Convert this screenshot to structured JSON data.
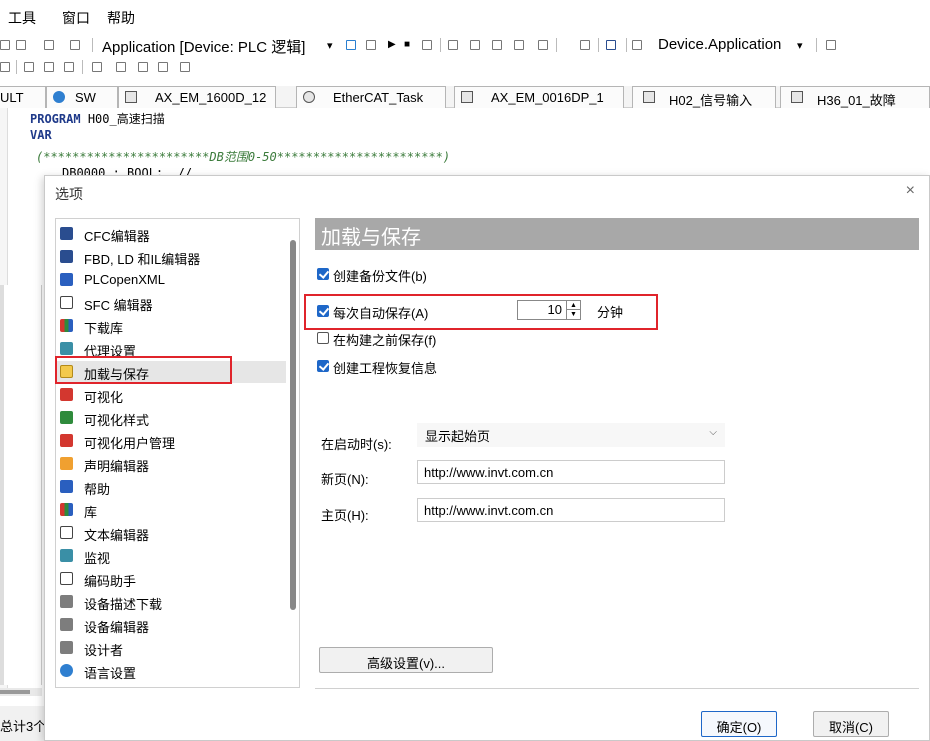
{
  "menu": {
    "items": [
      "工具",
      "窗口",
      "帮助"
    ]
  },
  "toolbar": {
    "app_combo": "Application [Device: PLC 逻辑]",
    "device_combo": "Device.Application"
  },
  "tabs": [
    {
      "label": "ULT"
    },
    {
      "label": "SW"
    },
    {
      "label": "AX_EM_1600D_12"
    },
    {
      "label": "EtherCAT_Task"
    },
    {
      "label": "AX_EM_0016DP_1"
    },
    {
      "label": "H02_信号输入"
    },
    {
      "label": "H36_01_故障"
    }
  ],
  "editor": {
    "line1_kw": "PROGRAM",
    "line1_name": "H00_高速扫描",
    "line2_kw": "VAR",
    "line3_comment": "(***********************DB范围0-50***********************)",
    "line4": "DB0000 : BOOL;  //"
  },
  "status": {
    "text": "总计3个"
  },
  "dialog": {
    "title": "选项",
    "close_glyph": "×",
    "categories": [
      {
        "label": "CFC编辑器",
        "icon": "cfc-editor-icon",
        "color": "navy"
      },
      {
        "label": "FBD, LD 和IL编辑器",
        "icon": "fbd-editor-icon",
        "color": "navy"
      },
      {
        "label": "PLCopenXML",
        "icon": "plcopenxml-icon",
        "color": "blue"
      },
      {
        "label": "SFC 编辑器",
        "icon": "sfc-editor-icon",
        "color": "outline"
      },
      {
        "label": "下载库",
        "icon": "library-download-icon",
        "color": "multi"
      },
      {
        "label": "代理设置",
        "icon": "proxy-icon",
        "color": "teal"
      },
      {
        "label": "加载与保存",
        "icon": "folder-icon",
        "color": "folder"
      },
      {
        "label": "可视化",
        "icon": "visualization-icon",
        "color": "red"
      },
      {
        "label": "可视化样式",
        "icon": "visual-style-icon",
        "color": "green"
      },
      {
        "label": "可视化用户管理",
        "icon": "user-management-icon",
        "color": "red"
      },
      {
        "label": "声明编辑器",
        "icon": "declaration-editor-icon",
        "color": "orange"
      },
      {
        "label": "帮助",
        "icon": "help-book-icon",
        "color": "blue"
      },
      {
        "label": "库",
        "icon": "library-icon",
        "color": "multi"
      },
      {
        "label": "文本编辑器",
        "icon": "text-editor-icon",
        "color": "outline"
      },
      {
        "label": "监视",
        "icon": "monitor-icon",
        "color": "teal"
      },
      {
        "label": "编码助手",
        "icon": "coding-assistant-icon",
        "color": "outline"
      },
      {
        "label": "设备描述下载",
        "icon": "device-description-icon",
        "color": "gray"
      },
      {
        "label": "设备编辑器",
        "icon": "device-editor-icon",
        "color": "gray"
      },
      {
        "label": "设计者",
        "icon": "designer-icon",
        "color": "gray"
      },
      {
        "label": "语言设置",
        "icon": "language-globe-icon",
        "color": "globe"
      }
    ],
    "selected_index": 6,
    "panel": {
      "heading": "加载与保存",
      "create_backup": {
        "label": "创建备份文件(b)",
        "checked": true
      },
      "auto_save": {
        "label": "每次自动保存(A)",
        "checked": true,
        "value": "10",
        "unit": "分钟"
      },
      "save_before_build": {
        "label": "在构建之前保存(f)",
        "checked": false
      },
      "create_recovery": {
        "label": "创建工程恢复信息",
        "checked": true
      },
      "on_startup_label": "在启动时(s):",
      "on_startup_value": "显示起始页",
      "new_page_label": "新页(N):",
      "new_page_value": "http://www.invt.com.cn",
      "home_page_label": "主页(H):",
      "home_page_value": "http://www.invt.com.cn",
      "advanced_label": "高级设置(v)..."
    },
    "ok_label": "确定(O)",
    "cancel_label": "取消(C)"
  },
  "colors": {
    "highlight": "#e0242b",
    "checkbox": "#1e67c8",
    "heading_bg": "#a8a8a8"
  }
}
